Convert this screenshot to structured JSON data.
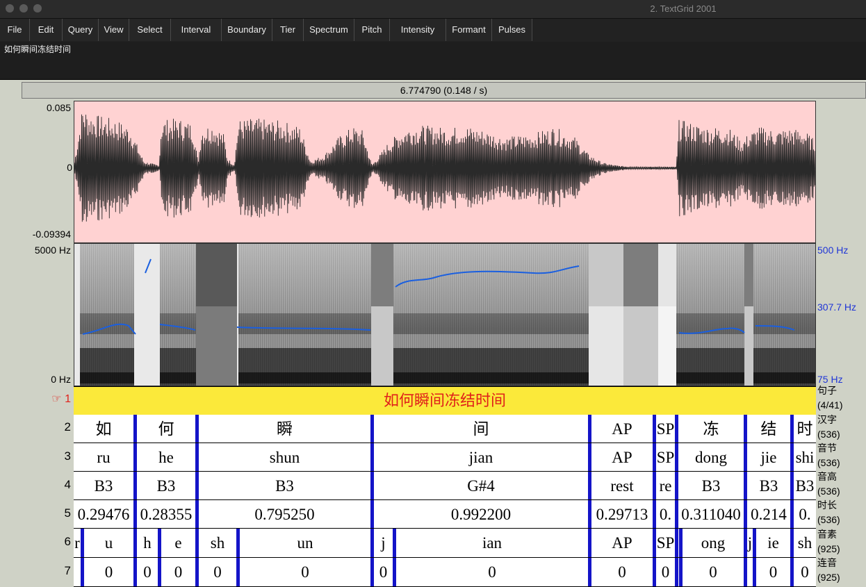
{
  "window": {
    "title": "2. TextGrid 2001"
  },
  "menu": [
    "File",
    "Edit",
    "Query",
    "View",
    "Select",
    "Interval",
    "Boundary",
    "Tier",
    "Spectrum",
    "Pitch",
    "Intensity",
    "Formant",
    "Pulses"
  ],
  "text_field": "如何瞬间冻结时间",
  "cursor_readout": "6.774790 (0.148 / s)",
  "waveform": {
    "max_label": "0.085",
    "zero_label": "0",
    "min_label": "-0.09394",
    "background": "#ffd2d2"
  },
  "spectrogram": {
    "top_label": "5000 Hz",
    "bottom_label": "0 Hz",
    "pitch_top": "500 Hz",
    "pitch_mid": "307.7 Hz",
    "pitch_bottom": "75 Hz",
    "pitch_color": "#1a5fe0"
  },
  "tiers": [
    {
      "num": "1",
      "name": "句子",
      "count": "(4/41)",
      "selected": true,
      "pointer": "☞",
      "cells": [
        {
          "text": "如何瞬间冻结时间"
        }
      ]
    },
    {
      "num": "2",
      "name": "汉字",
      "count": "(536)",
      "cells": [
        {
          "text": "如"
        },
        {
          "text": "何"
        },
        {
          "text": "瞬"
        },
        {
          "text": "间"
        },
        {
          "text": "AP"
        },
        {
          "text": "SP"
        },
        {
          "text": "冻"
        },
        {
          "text": "结"
        },
        {
          "text": "时"
        }
      ]
    },
    {
      "num": "3",
      "name": "音节",
      "count": "(536)",
      "cells": [
        {
          "text": "ru"
        },
        {
          "text": "he"
        },
        {
          "text": "shun"
        },
        {
          "text": "jian"
        },
        {
          "text": "AP"
        },
        {
          "text": "SP"
        },
        {
          "text": "dong"
        },
        {
          "text": "jie"
        },
        {
          "text": "shi"
        }
      ]
    },
    {
      "num": "4",
      "name": "音高",
      "count": "(536)",
      "cells": [
        {
          "text": "B3"
        },
        {
          "text": "B3"
        },
        {
          "text": "B3"
        },
        {
          "text": "G#4"
        },
        {
          "text": "rest"
        },
        {
          "text": "re"
        },
        {
          "text": "B3"
        },
        {
          "text": "B3"
        },
        {
          "text": "B3"
        }
      ]
    },
    {
      "num": "5",
      "name": "时长",
      "count": "(536)",
      "cells": [
        {
          "text": "0.29476"
        },
        {
          "text": "0.28355"
        },
        {
          "text": "0.795250"
        },
        {
          "text": "0.992200"
        },
        {
          "text": "0.29713"
        },
        {
          "text": "0."
        },
        {
          "text": "0.311040"
        },
        {
          "text": "0.214"
        },
        {
          "text": "0."
        }
      ]
    },
    {
      "num": "6",
      "name": "音素",
      "count": "(925)",
      "cells": [
        {
          "text": "r"
        },
        {
          "text": "u"
        },
        {
          "text": "h"
        },
        {
          "text": "e"
        },
        {
          "text": "sh"
        },
        {
          "text": "un"
        },
        {
          "text": "j"
        },
        {
          "text": "ian"
        },
        {
          "text": "AP"
        },
        {
          "text": "SP"
        },
        {
          "text": ""
        },
        {
          "text": "ong"
        },
        {
          "text": "j"
        },
        {
          "text": "ie"
        },
        {
          "text": "sh"
        }
      ]
    },
    {
      "num": "7",
      "name": "连音",
      "count": "(925)",
      "cells": [
        {
          "text": ""
        },
        {
          "text": "0"
        },
        {
          "text": "0"
        },
        {
          "text": "0"
        },
        {
          "text": "0"
        },
        {
          "text": "0"
        },
        {
          "text": "0"
        },
        {
          "text": "0"
        },
        {
          "text": "0"
        },
        {
          "text": "0"
        },
        {
          "text": ""
        },
        {
          "text": "0"
        },
        {
          "text": ""
        },
        {
          "text": "0"
        },
        {
          "text": "0"
        }
      ]
    }
  ]
}
